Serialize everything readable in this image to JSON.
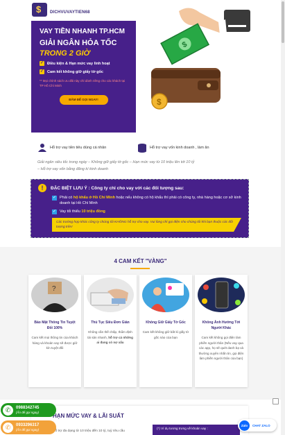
{
  "header": {
    "logo_text": "DICHVUVAYTIEN68"
  },
  "hero": {
    "line1": "VAY TIỀN NHANH TP.HCM",
    "line2": "GIẢI NGÂN HỎA TỐC",
    "line3": "TRONG 2 GIỜ",
    "bullets": [
      "Điều kiện & Hạn mức vay linh hoạt",
      "Cam kết không giữ giấy tờ gốc"
    ],
    "note": "** Mọi chính sách ưu đãi này chỉ dành riêng cho các khách tại TP Hồ Chí Minh",
    "cta": "BẤM ĐỂ GỌI NGAY!"
  },
  "services": {
    "personal": "Hỗ trợ vay tiền tiêu dùng cá nhân",
    "business": "Hỗ trợ vay vốn kinh doanh , làm ăn",
    "sub1": "Giải ngân siêu tốc trong ngày – Không giữ giấy tờ gốc – Hạn mức vay từ 10 triệu lên tới 10 tỷ",
    "sub2": "– Hỗ trợ vay vốn bằng đăng kí kinh doanh"
  },
  "notice": {
    "title": "ĐẶC BIỆT LƯU Ý : Công ty chỉ cho vay với các đối tượng sau:",
    "item1_a": "Phải có ",
    "item1_hl1": "hộ khẩu ở Hồ Chí Minh",
    "item1_b": " hoặc nếu không có hộ khẩu thì phải có công ty, nhà hàng hoặc cơ sở kinh doanh tại Hồ Chí Minh",
    "item2_a": "Vay tối thiểu ",
    "item2_hl": "10 triệu đồng",
    "banner": "Các trường hợp khác công ty chúng tôi KHÔNG hỗ trợ cho vay. Vui lòng chỉ gọi điện cho chúng tôi khi bạn thuộc các đối tượng trên!"
  },
  "commitments": {
    "title": "4 CAM KẾT \"VÀNG\"",
    "cards": [
      {
        "title": "Bảo Mật Thông Tin Tuyệt Đối 100%",
        "desc": "Cam kết mọi thông tin của khách hàng và khoản vay sẽ được giữ kín tuyệt đối"
      },
      {
        "title": "Thủ Tục Siêu Đơn Giản",
        "desc_a": "Không cần thế chấp, thẩm định tài sản nhanh, ",
        "desc_b": "hỗ trợ cả những ai đang có nợ xấu"
      },
      {
        "title": "Không Giữ Giấy Tờ Gốc",
        "desc": "Cam kết không giữ bất kì giấy tờ gốc nào của bạn"
      },
      {
        "title": "Không Ảnh Hưởng Tới Người Khác",
        "desc": "Cam kết không gọi điện làm phiền người thân (Nếu vay qua các app, họ sẽ quét danh bạ và thường xuyên nhắn tin, gọi điện làm phiền người thân của bạn)"
      }
    ]
  },
  "rates": {
    "title": "HẠN MỨC VAY & LÃI SUẤT",
    "sub": "Hỗ trợ đa dạng từ 10 triệu đến 10 tỷ, tuỳ nhu cầu",
    "note": "(*) Ví dụ tương trưng về khoản vay :"
  },
  "floating": {
    "phone1": "0988342745",
    "phone1_sub": "(Ấn để gọi ngay)",
    "phone2": "0933296317",
    "phone2_sub": "(Ấn để gọi ngay)",
    "zalo_logo": "Zalo",
    "zalo_label": "CHAT ZALO"
  },
  "colors": {
    "brand": "#47208a",
    "accent": "#f7a900",
    "highlight": "#ffcc00",
    "phone1": "#1f9a1f",
    "phone2": "#f2a23a",
    "zalo": "#0a68ff"
  }
}
